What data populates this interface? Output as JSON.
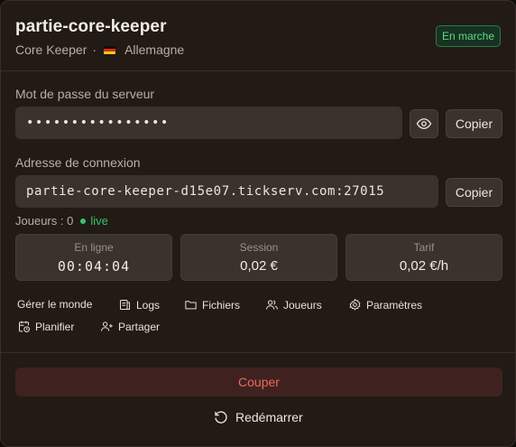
{
  "server": {
    "name": "partie-core-keeper",
    "game": "Core Keeper",
    "separator": "·",
    "location": "Allemagne",
    "status": "En marche"
  },
  "password": {
    "label": "Mot de passe du serveur",
    "masked_value": "••••••••••••••••",
    "copy_label": "Copier"
  },
  "connection": {
    "label": "Adresse de connexion",
    "address": "partie-core-keeper-d15e07.tickserv.com:27015",
    "copy_label": "Copier"
  },
  "players": {
    "label": "Joueurs : 0",
    "live_label": "live"
  },
  "stats": [
    {
      "label": "En ligne",
      "value": "00:04:04"
    },
    {
      "label": "Session",
      "value": "0,02 €"
    },
    {
      "label": "Tarif",
      "value": "0,02 €/h"
    }
  ],
  "actions": {
    "manage": "Gérer le monde",
    "logs": "Logs",
    "files": "Fichiers",
    "players": "Joueurs",
    "settings": "Paramètres",
    "schedule": "Planifier",
    "share": "Partager"
  },
  "stop_label": "Couper",
  "restart_label": "Redémarrer",
  "colors": {
    "status": "#5fdc84",
    "live": "#36c46a",
    "danger": "#e86b5f"
  },
  "icons": [
    "flag-germany-icon",
    "eye-icon",
    "logs-icon",
    "folder-icon",
    "users-icon",
    "gear-icon",
    "calendar-clock-icon",
    "user-plus-icon",
    "restart-icon"
  ]
}
